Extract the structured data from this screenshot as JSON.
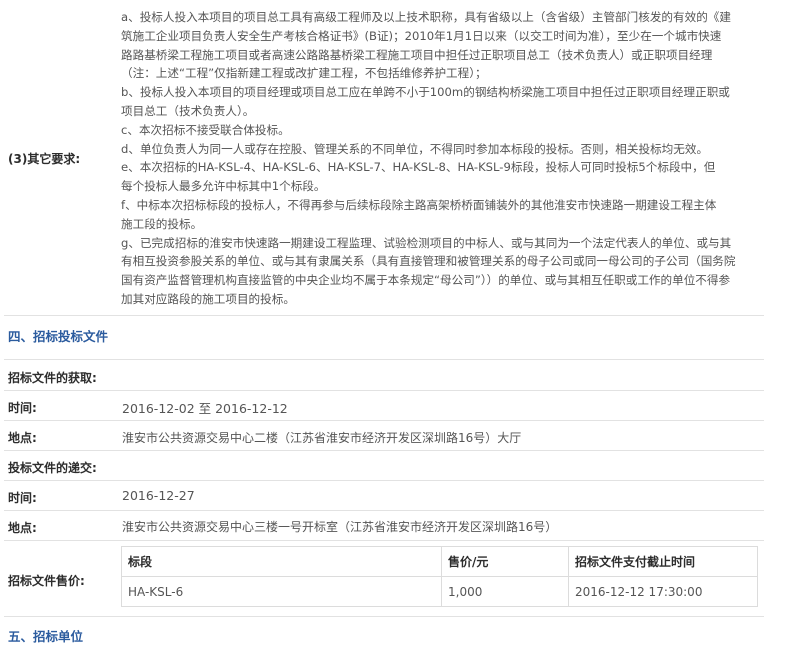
{
  "other_requirements": {
    "label": "(3)其它要求:",
    "lines": [
      "a、投标人投入本项目的项目总工具有高级工程师及以上技术职称，具有省级以上（含省级）主管部门核发的有效的《建",
      "筑施工企业项目负责人安全生产考核合格证书》(B证)；2010年1月1日以来（以交工时间为准），至少在一个城市快速",
      "路路基桥梁工程施工项目或者高速公路路基桥梁工程施工项目中担任过正职项目总工（技术负责人）或正职项目经理",
      "（注：上述“工程”仅指新建工程或改扩建工程，不包括维修养护工程）；",
      "b、投标人投入本项目的项目经理或项目总工应在单跨不小于100m的钢结构桥梁施工项目中担任过正职项目经理正职或",
      "项目总工（技术负责人）。",
      "c、本次招标不接受联合体投标。",
      "d、单位负责人为同一人或存在控股、管理关系的不同单位，不得同时参加本标段的投标。否则，相关投标均无效。",
      "e、本次招标的HA-KSL-4、HA-KSL-6、HA-KSL-7、HA-KSL-8、HA-KSL-9标段，投标人可同时投标5个标段中，但",
      "每个投标人最多允许中标其中1个标段。",
      "f、中标本次招标标段的投标人，不得再参与后续标段除主路高架桥桥面铺装外的其他淮安市快速路一期建设工程主体",
      "施工段的投标。",
      "g、已完成招标的淮安市快速路一期建设工程监理、试验检测项目的中标人、或与其同为一个法定代表人的单位、或与其",
      "有相互投资参股关系的单位、或与其有隶属关系（具有直接管理和被管理关系的母子公司或同一母公司的子公司（国务院",
      "国有资产监督管理机构直接监管的中央企业均不属于本条规定“母公司”））的单位、或与其相互任职或工作的单位不得参",
      "加其对应路段的施工项目的投标。"
    ]
  },
  "section4": {
    "title": "四、招标投标文件"
  },
  "obtain": {
    "label": "招标文件的获取:",
    "time_label": "时间:",
    "time_value": "2016-12-02 至 2016-12-12",
    "place_label": "地点:",
    "place_value": "淮安市公共资源交易中心二楼（江苏省淮安市经济开发区深圳路16号）大厅"
  },
  "submit": {
    "label": "投标文件的递交:",
    "time_label": "时间:",
    "time_value": "2016-12-27",
    "place_label": "地点:",
    "place_value": "淮安市公共资源交易中心三楼一号开标室（江苏省淮安市经济开发区深圳路16号）"
  },
  "price": {
    "label": "招标文件售价:",
    "headers": [
      "标段",
      "售价/元",
      "招标文件支付截止时间"
    ],
    "row": [
      "HA-KSL-6",
      "1,000",
      "2016-12-12 17:30:00"
    ]
  },
  "section5": {
    "title": "五、招标单位"
  }
}
